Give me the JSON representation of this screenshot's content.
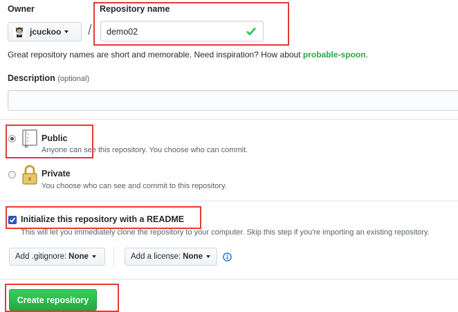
{
  "owner": {
    "label": "Owner",
    "username": "jcuckoo"
  },
  "separator": "/",
  "repo_name": {
    "label": "Repository name",
    "value": "demo02"
  },
  "name_hint": {
    "text": "Great repository names are short and memorable. Need inspiration? How about ",
    "suggestion": "probable-spoon",
    "end": "."
  },
  "description": {
    "label": "Description",
    "optional": "(optional)",
    "value": ""
  },
  "visibility": {
    "public": {
      "title": "Public",
      "desc": "Anyone can see this repository. You choose who can commit.",
      "selected": true
    },
    "private": {
      "title": "Private",
      "desc": "You choose who can see and commit to this repository.",
      "selected": false
    }
  },
  "readme": {
    "label": "Initialize this repository with a README",
    "desc": "This will let you immediately clone the repository to your computer. Skip this step if you're importing an existing repository.",
    "checked": true
  },
  "gitignore": {
    "label": "Add .gitignore:",
    "value": "None"
  },
  "license": {
    "label": "Add a license:",
    "value": "None"
  },
  "create_button": "Create repository",
  "colors": {
    "accent_green": "#2cbe4e",
    "suggestion_green": "#28a745",
    "annotation_red": "#e53935",
    "info_blue": "#0366d6"
  },
  "icons": {
    "owner_avatar": "octocat-avatar-icon",
    "valid": "check-icon",
    "public": "repo-book-icon",
    "private": "lock-icon",
    "info": "info-icon"
  }
}
